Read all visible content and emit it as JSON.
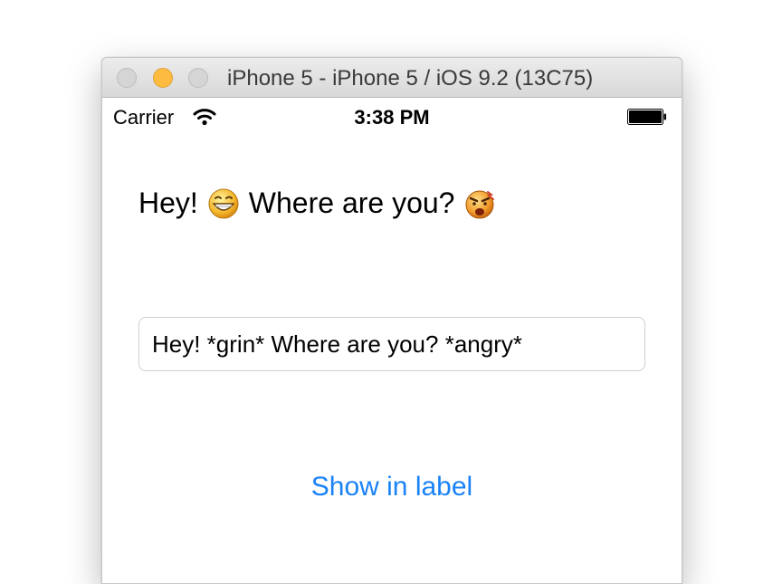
{
  "window": {
    "title": "iPhone 5 - iPhone 5 / iOS 9.2 (13C75)"
  },
  "status_bar": {
    "carrier": "Carrier",
    "time": "3:38 PM",
    "icons": [
      "wifi-icon",
      "battery-icon"
    ]
  },
  "label": {
    "part1": "Hey!",
    "emoji1": "grin-emoji",
    "part2": "Where are you?",
    "emoji2": "angry-emoji"
  },
  "text_field": {
    "value": "Hey! *grin* Where are you? *angry*"
  },
  "button": {
    "label": "Show in label"
  },
  "colors": {
    "accent": "#1a82f7",
    "minimize": "#fdbc40"
  }
}
